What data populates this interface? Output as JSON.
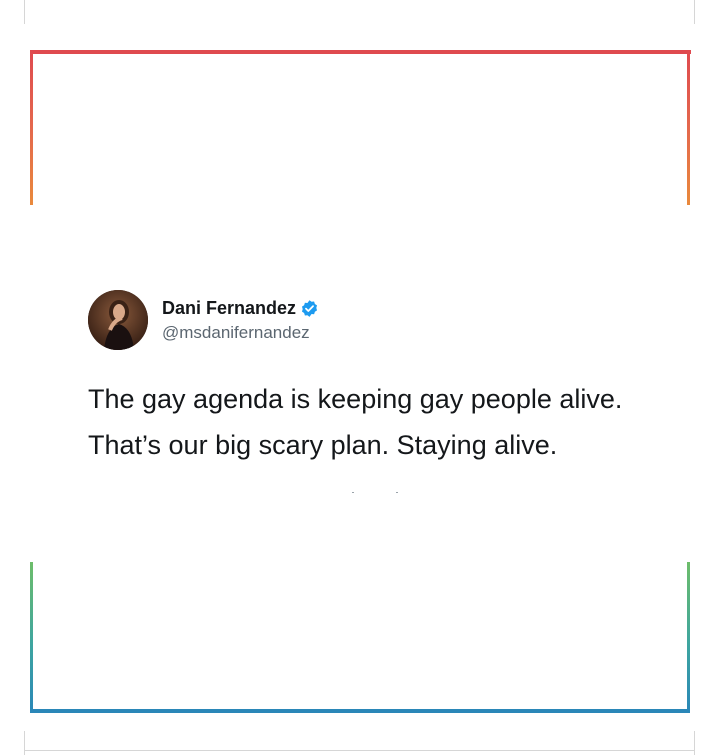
{
  "tweet": {
    "author": {
      "display_name": "Dani Fernandez",
      "handle": "@msdanifernandez",
      "verified": true,
      "avatar_icon": "profile-photo"
    },
    "text_lines": [
      "The gay agenda is keeping gay people alive.",
      "That’s our big scary plan. Staying alive."
    ]
  },
  "colors": {
    "frame_top": "#df4a4f",
    "frame_top_lower": "#e9893c",
    "frame_bottom_upper": "#6dbd6a",
    "frame_bottom": "#2a87b8",
    "verified_badge": "#1d9bf0",
    "text": "#14171a",
    "handle": "#5b6670"
  }
}
